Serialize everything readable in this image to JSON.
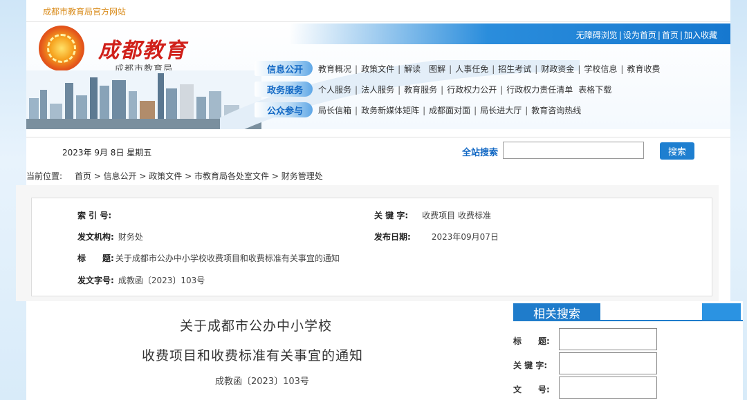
{
  "site": {
    "top_name": "成都市教育局官方网站"
  },
  "header": {
    "brand": "成都教育",
    "brand_sub": "成都市教育局",
    "top_links": [
      "无障碍浏览",
      "设为首页",
      "首页",
      "加入收藏"
    ]
  },
  "nav": [
    {
      "tag": "信息公开",
      "links": [
        "教育概况",
        "政策文件",
        "解读　图解",
        "人事任免",
        "招生考试",
        "财政资金",
        "学校信息",
        "教育收费"
      ]
    },
    {
      "tag": "政务服务",
      "links": [
        "个人服务",
        "法人服务",
        "教育服务",
        "行政权力公开",
        "行政权力责任清单",
        "表格下载"
      ]
    },
    {
      "tag": "公众参与",
      "links": [
        "局长信箱",
        "政务新媒体矩阵",
        "成都面对面",
        "局长进大厅",
        "教育咨询热线"
      ]
    }
  ],
  "datebar": {
    "date": "2023年  9月  8日  星期五",
    "search_label": "全站搜索",
    "search_value": "",
    "search_button": "搜索"
  },
  "breadcrumb": {
    "label": "当前位置:",
    "items": [
      "首页",
      "信息公开",
      "政策文件",
      "市教育局各处室文件",
      "财务管理处"
    ]
  },
  "info": {
    "index_label": "索 引 号:",
    "index_value": "",
    "keywords_label": "关 键 字:",
    "keywords_value": "收费项目 收费标准",
    "issuer_label": "发文机构:",
    "issuer_value": "财务处",
    "date_label": "发布日期:",
    "date_value": "2023年09月07日",
    "title_label": "标　　题:",
    "title_value": "关于成都市公办中小学校收费项目和收费标准有关事宜的通知",
    "docno_label": "发文字号:",
    "docno_value": "成教函〔2023〕103号"
  },
  "article": {
    "title_line1": "关于成都市公办中小学校",
    "title_line2": "收费项目和收费标准有关事宜的通知",
    "doc_number": "成教函〔2023〕103号"
  },
  "related": {
    "heading": "相关搜索",
    "fields": [
      {
        "label": "标　　题:",
        "value": ""
      },
      {
        "label": "关 键 字:",
        "value": ""
      },
      {
        "label": "文　　号:",
        "value": ""
      }
    ]
  },
  "colors": {
    "accent": "#1e7fd0",
    "brand_red": "#d0201a",
    "site_orange": "#d98b1a"
  }
}
